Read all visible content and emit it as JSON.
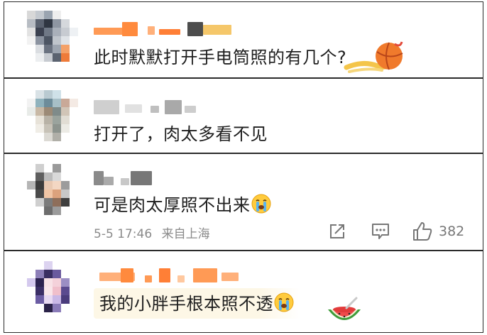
{
  "comments": [
    {
      "id": "c1",
      "username_blurred": true,
      "text": "此时默默打开手电筒照的有几个?",
      "sticker": "basketball-sticker"
    },
    {
      "id": "c2",
      "username_blurred": true,
      "text": "打开了，肉太多看不见"
    },
    {
      "id": "c3",
      "username_blurred": true,
      "text": "可是肉太厚照不出来",
      "emoji": "crying-face-emoji",
      "timestamp": "5-5 17:46",
      "location": "来自上海",
      "like_count": "382"
    },
    {
      "id": "c4",
      "username_blurred": true,
      "text": "我的小胖手根本照不透",
      "emoji": "crying-face-emoji",
      "sticker": "watermelon-sticker"
    }
  ],
  "colors": {
    "text": "#1e1e1e",
    "meta": "#8a8a8a",
    "icon": "#777777",
    "border": "#2b2b2b",
    "username_orange": "#ff8a3d"
  }
}
